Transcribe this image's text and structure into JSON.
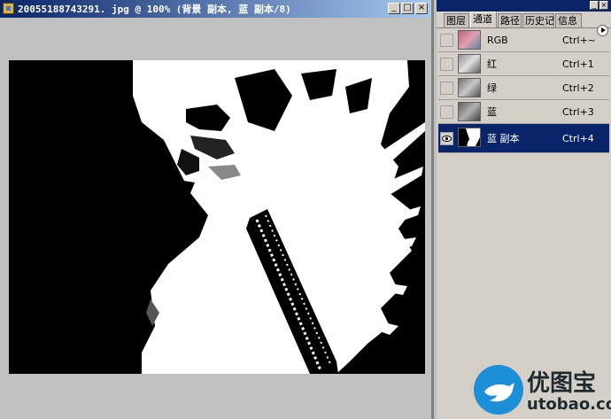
{
  "document": {
    "title": "20055188743291. jpg @ 100% (背景 副本, 蓝 副本/8)",
    "buttons": {
      "minimize": "_",
      "maximize": "□",
      "close": "×"
    }
  },
  "palette": {
    "tabs": [
      {
        "label": "图层",
        "active": false
      },
      {
        "label": "通道",
        "active": true
      },
      {
        "label": "路径",
        "active": false
      },
      {
        "label": "历史记录",
        "active": false
      },
      {
        "label": "信息",
        "active": false
      }
    ],
    "title_buttons": {
      "minimize": "_",
      "close": "×"
    },
    "channels": [
      {
        "name": "RGB",
        "shortcut": "Ctrl+~",
        "visible": false,
        "selected": false,
        "thumb": "color"
      },
      {
        "name": "红",
        "shortcut": "Ctrl+1",
        "visible": false,
        "selected": false,
        "thumb": "gray"
      },
      {
        "name": "绿",
        "shortcut": "Ctrl+2",
        "visible": false,
        "selected": false,
        "thumb": "gray"
      },
      {
        "name": "蓝",
        "shortcut": "Ctrl+3",
        "visible": false,
        "selected": false,
        "thumb": "gray"
      },
      {
        "name": "蓝 副本",
        "shortcut": "Ctrl+4",
        "visible": true,
        "selected": true,
        "thumb": "mask"
      }
    ]
  },
  "watermark": {
    "brand": "优图宝",
    "url": "utobao.com"
  },
  "colors": {
    "title_active": "#0a246a",
    "selection": "#0a246a",
    "panel": "#d4d0c8",
    "workspace": "#c0c0c0"
  }
}
